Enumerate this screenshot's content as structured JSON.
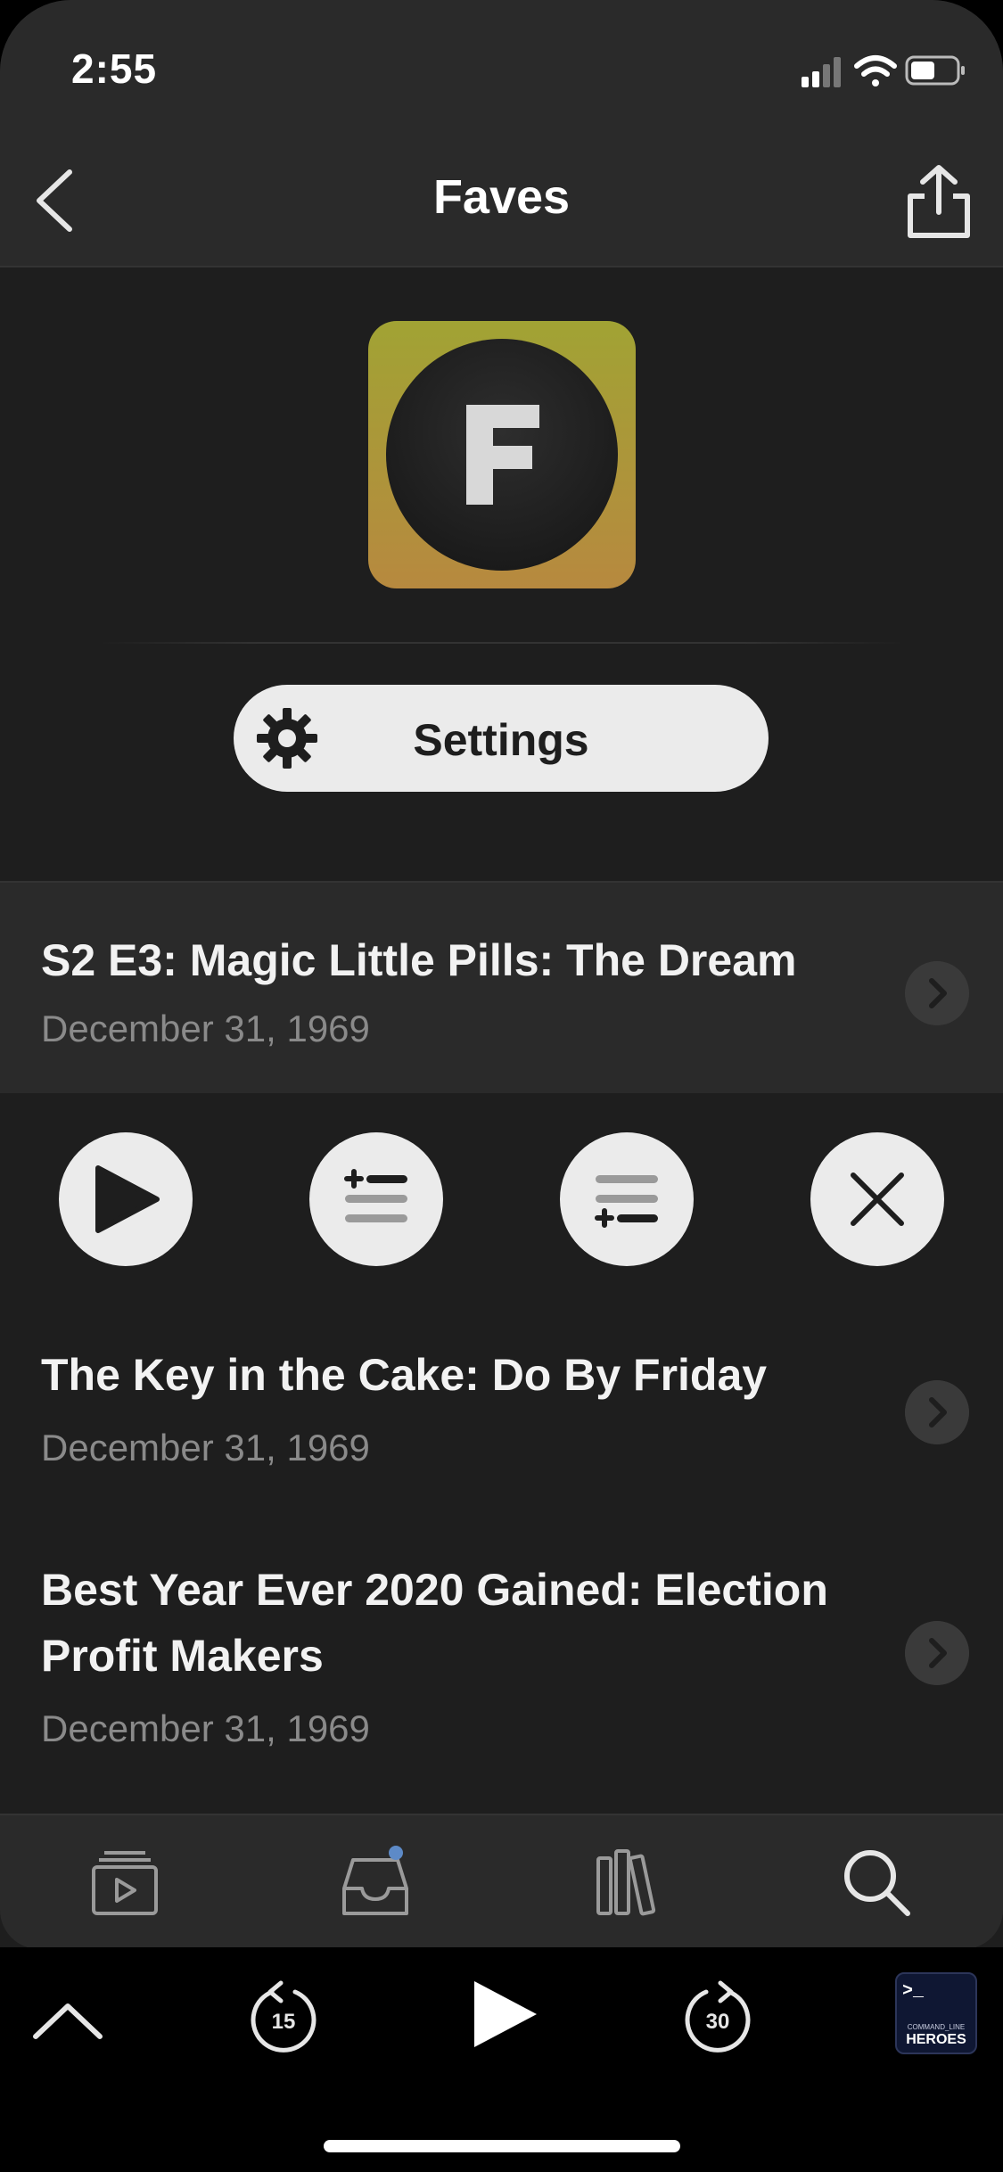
{
  "status": {
    "time": "2:55"
  },
  "nav": {
    "title": "Faves"
  },
  "filter": {
    "icon_letter": "F",
    "settings_label": "Settings"
  },
  "episodes": [
    {
      "title": "S2 E3: Magic Little Pills: The Dream",
      "date": "December 31, 1969"
    },
    {
      "title": "The Key in the Cake: Do By Friday",
      "date": "December 31, 1969"
    },
    {
      "title": "Best Year Ever 2020 Gained: Election Profit Makers",
      "date": "December 31, 1969"
    }
  ],
  "player": {
    "skip_back": "15",
    "skip_forward": "30",
    "artwork_line1": ">_",
    "artwork_line2": "COMMAND_LINE",
    "artwork_line3": "HEROES"
  },
  "colors": {
    "background": "#1e1e1e",
    "header": "#2a2a2a",
    "accent_dot": "#5d8ac7",
    "filter_gradient_top": "#a1a334",
    "filter_gradient_bottom": "#b7893f"
  },
  "icons": {
    "back": "chevron-left-icon",
    "share": "share-icon",
    "settings": "gear-icon",
    "actions": [
      "play-icon",
      "play-next-icon",
      "play-last-icon",
      "close-icon"
    ],
    "tabs": [
      "podcasts-icon",
      "inbox-icon",
      "library-icon",
      "search-icon"
    ]
  }
}
